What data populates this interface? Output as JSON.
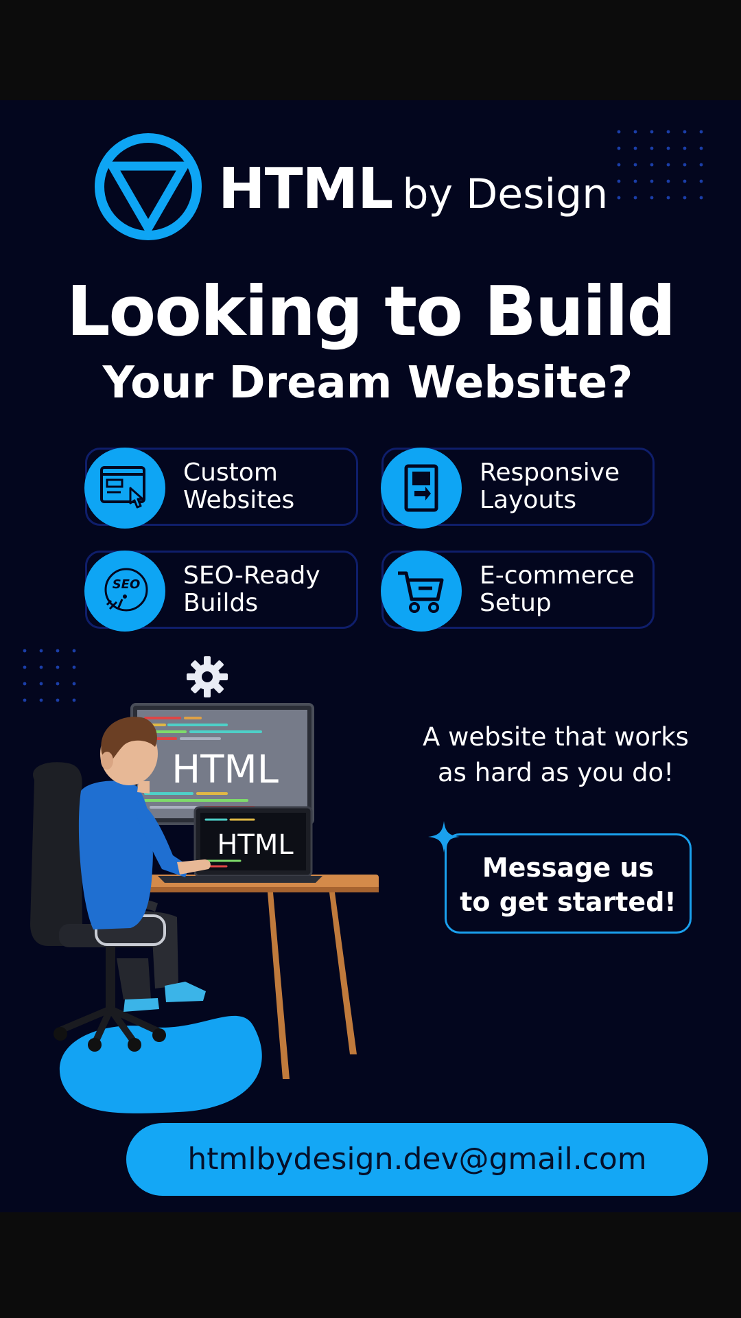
{
  "brand": {
    "name_bold": "HTML",
    "name_rest": "by Design",
    "logo_icon": "triangle-in-circle-icon",
    "accent_color": "#0ea5f4"
  },
  "headline": {
    "line1": "Looking to Build",
    "line2": "Your Dream Website?"
  },
  "features": [
    {
      "line1": "Custom",
      "line2": "Websites",
      "icon": "browser-click-icon"
    },
    {
      "line1": "Responsive",
      "line2": "Layouts",
      "icon": "mobile-device-icon"
    },
    {
      "line1": "SEO-Ready",
      "line2": "Builds",
      "icon": "seo-icon"
    },
    {
      "line1": "E-commerce",
      "line2": "Setup",
      "icon": "shopping-cart-icon"
    }
  ],
  "illustration": {
    "monitor_text": "HTML",
    "laptop_text": "HTML",
    "seo_badge_text": "SEO"
  },
  "tagline": {
    "line1": "A website that works",
    "line2": "as hard as you do!"
  },
  "cta": {
    "line1": "Message us",
    "line2": "to get started!"
  },
  "contact": {
    "email": "htmlbydesign.dev@gmail.com"
  }
}
